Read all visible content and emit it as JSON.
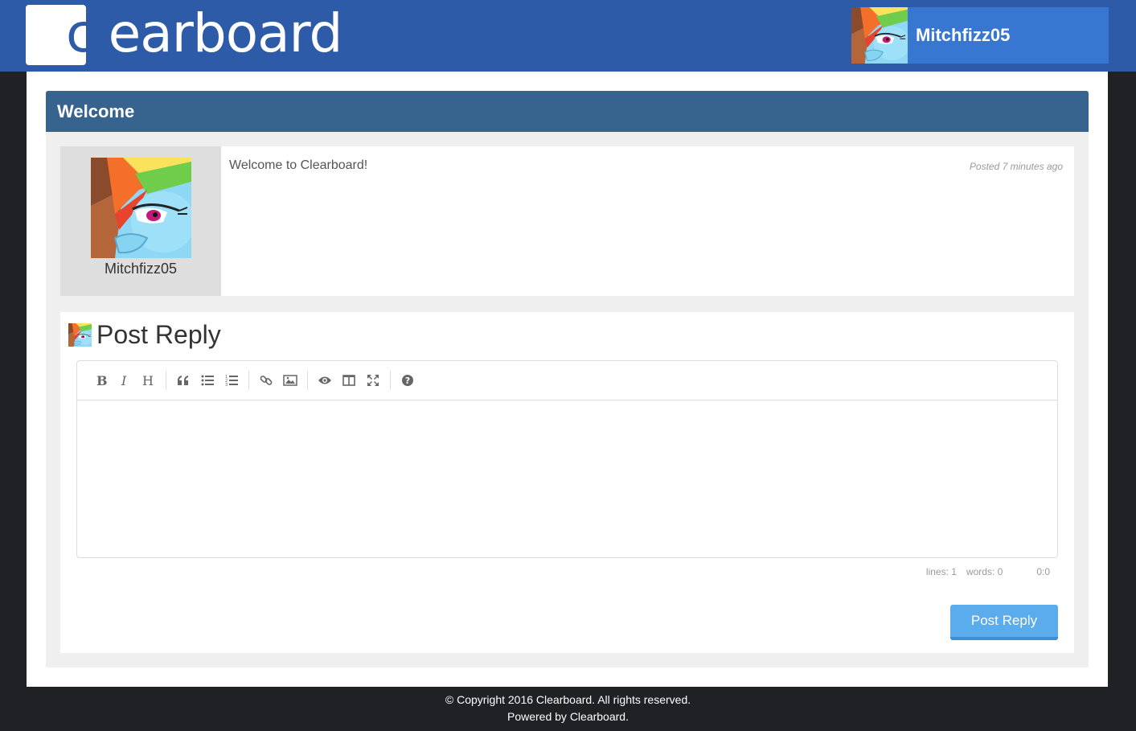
{
  "header": {
    "logo_text_c": "c",
    "logo_text_l": "l",
    "logo_text_rest": "earboard",
    "username": "Mitchfizz05"
  },
  "topic": {
    "title": "Welcome"
  },
  "post": {
    "author": "Mitchfizz05",
    "content": "Welcome to Clearboard!",
    "posted": "Posted 7 minutes ago"
  },
  "reply": {
    "title": "Post Reply",
    "toolbar": [
      "bold-icon",
      "italic-icon",
      "heading-icon",
      "quote-icon",
      "unordered-list-icon",
      "ordered-list-icon",
      "link-icon",
      "image-icon",
      "preview-icon",
      "side-by-side-icon",
      "fullscreen-icon",
      "help-icon"
    ],
    "status_lines": "lines: 1",
    "status_words": "words: 0",
    "status_cursor": "0:0",
    "submit_label": "Post Reply"
  },
  "footer": {
    "copyright": "© Copyright 2016 Clearboard. All rights reserved.",
    "powered": "Powered by Clearboard."
  },
  "colors": {
    "header": "#2d5ba7",
    "user_box": "#3877d1",
    "panel_head": "#37638f",
    "button": "#5aacec"
  }
}
